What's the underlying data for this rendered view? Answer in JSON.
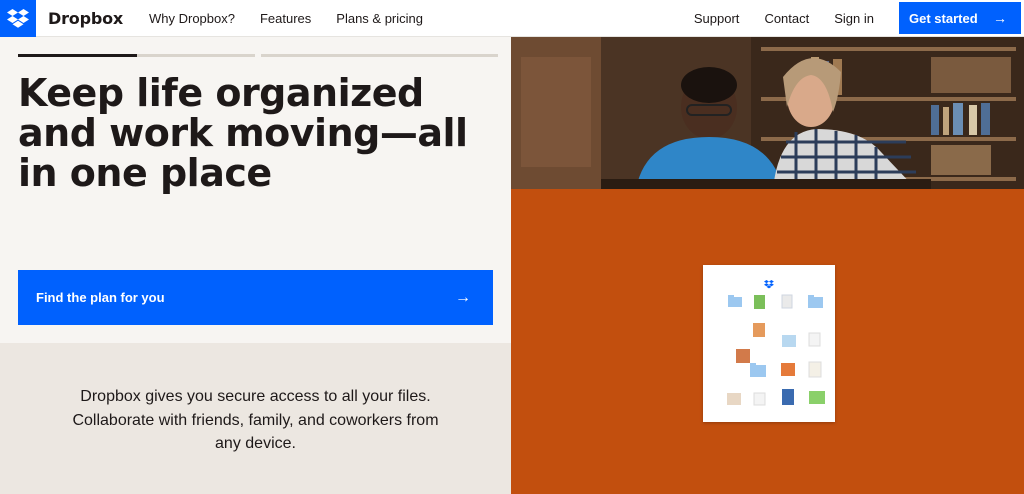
{
  "nav": {
    "brand": "Dropbox",
    "links": [
      "Why Dropbox?",
      "Features",
      "Plans & pricing"
    ],
    "right_links": [
      "Support",
      "Contact",
      "Sign in"
    ],
    "cta_label": "Get started",
    "cta_arrow": "→"
  },
  "hero": {
    "headline_lines": [
      "Keep life organized",
      "and work moving—all",
      "in one place"
    ],
    "plan_button": "Find the plan for you",
    "plan_arrow": "→",
    "carousel_progress": 0.5
  },
  "description": {
    "lines": [
      "Dropbox gives you secure access to all your files.",
      "Collaborate with friends, family, and coworkers from",
      "any device."
    ]
  },
  "colors": {
    "primary": "#0061fe",
    "accent_orange": "#c24f0e",
    "bg_light": "#f7f5f2",
    "bg_beige": "#ece7e1",
    "text": "#1e1919"
  },
  "icons": [
    "dropbox-logo-icon",
    "arrow-right-icon",
    "folder-icon",
    "file-icon"
  ]
}
